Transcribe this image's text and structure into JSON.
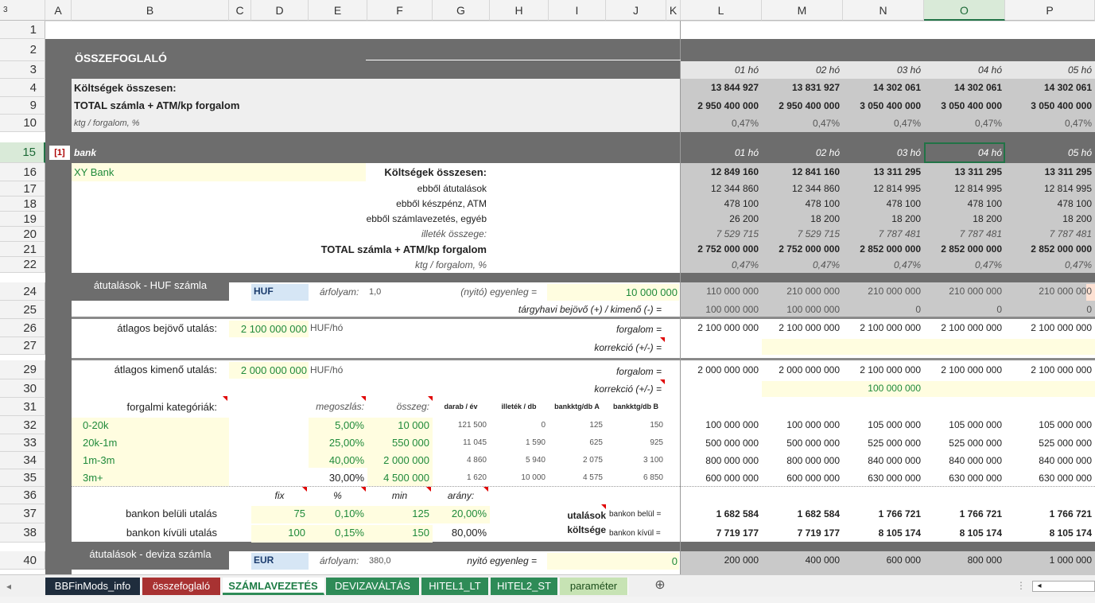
{
  "corner": "3",
  "columns": [
    "A",
    "B",
    "C",
    "D",
    "E",
    "F",
    "G",
    "H",
    "I",
    "J",
    "K",
    "L",
    "M",
    "N",
    "O",
    "P"
  ],
  "selected_column": "O",
  "rows": [
    "1",
    "2",
    "3",
    "4",
    "9",
    "10",
    "15",
    "16",
    "17",
    "18",
    "19",
    "20",
    "21",
    "22",
    "24",
    "25",
    "26",
    "27",
    "29",
    "30",
    "31",
    "32",
    "33",
    "34",
    "35",
    "36",
    "37",
    "38",
    "40"
  ],
  "selected_row": "15",
  "summary": {
    "title": "ÖSSZEFOGLALÓ",
    "months": [
      "01 hó",
      "02 hó",
      "03 hó",
      "04 hó",
      "05 hó"
    ],
    "row4_label": "Költségek összesen:",
    "row4_values": [
      "13 844 927",
      "13 831 927",
      "14 302 061",
      "14 302 061",
      "14 302 061"
    ],
    "row9_label": "TOTAL számla + ATM/kp forgalom",
    "row9_values": [
      "2 950 400 000",
      "2 950 400 000",
      "3 050 400 000",
      "3 050 400 000",
      "3 050 400 000"
    ],
    "row10_label": "ktg / forgalom, %",
    "row10_values": [
      "0,47%",
      "0,47%",
      "0,47%",
      "0,47%",
      "0,47%"
    ]
  },
  "bank": {
    "index": "[1]",
    "label": "bank",
    "months": [
      "01 hó",
      "02 hó",
      "03 hó",
      "04 hó",
      "05 hó"
    ],
    "name": "XY Bank",
    "r16_label": "Költségek összesen:",
    "r16": [
      "12 849 160",
      "12 841 160",
      "13 311 295",
      "13 311 295",
      "13 311 295"
    ],
    "r17_label": "ebből átutalások",
    "r17": [
      "12 344 860",
      "12 344 860",
      "12 814 995",
      "12 814 995",
      "12 814 995"
    ],
    "r18_label": "ebből készpénz, ATM",
    "r18": [
      "478 100",
      "478 100",
      "478 100",
      "478 100",
      "478 100"
    ],
    "r19_label": "ebből számlavezetés, egyéb",
    "r19": [
      "26 200",
      "18 200",
      "18 200",
      "18 200",
      "18 200"
    ],
    "r20_label": "illeték összege:",
    "r20": [
      "7 529 715",
      "7 529 715",
      "7 787 481",
      "7 787 481",
      "7 787 481"
    ],
    "r21_label": "TOTAL számla + ATM/kp forgalom",
    "r21": [
      "2 752 000 000",
      "2 752 000 000",
      "2 852 000 000",
      "2 852 000 000",
      "2 852 000 000"
    ],
    "r22_label": "ktg / forgalom, %",
    "r22": [
      "0,47%",
      "0,47%",
      "0,47%",
      "0,47%",
      "0,47%"
    ]
  },
  "huf": {
    "section_title": "átutalások - HUF számla",
    "currency": "HUF",
    "rate_label": "árfolyam:",
    "rate": "1,0",
    "opening_label": "(nyitó) egyenleg =",
    "opening": "10 000 000",
    "r24": [
      "110 000 000",
      "210 000 000",
      "210 000 000",
      "210 000 000",
      "210 000 000"
    ],
    "r25_label": "tárgyhavi bejövő (+) / kimenő (-) =",
    "r25": [
      "100 000 000",
      "100 000 000",
      "0",
      "0",
      "0"
    ],
    "in_label": "átlagos bejövő utalás:",
    "in_value": "2 100 000 000",
    "unit": "HUF/hó",
    "forgalom_label": "forgalom =",
    "r26": [
      "2 100 000 000",
      "2 100 000 000",
      "2 100 000 000",
      "2 100 000 000",
      "2 100 000 000"
    ],
    "korr_label": "korrekció (+/-) =",
    "out_label": "átlagos kimenő utalás:",
    "out_value": "2 000 000 000",
    "r29": [
      "2 000 000 000",
      "2 000 000 000",
      "2 100 000 000",
      "2 100 000 000",
      "2 100 000 000"
    ],
    "r30_n": "100 000 000"
  },
  "categories": {
    "label": "forgalmi kategóriák:",
    "headers": [
      "megoszlás:",
      "összeg:",
      "darab / év",
      "illeték / db",
      "bankktg/db A",
      "bankktg/db B"
    ],
    "rows": [
      {
        "name": "0-20k",
        "share": "5,00%",
        "amount": "10 000",
        "count": "121 500",
        "fee": "0",
        "a": "125",
        "b": "150",
        "m": [
          "100 000 000",
          "100 000 000",
          "105 000 000",
          "105 000 000",
          "105 000 000"
        ]
      },
      {
        "name": "20k-1m",
        "share": "25,00%",
        "amount": "550 000",
        "count": "11 045",
        "fee": "1 590",
        "a": "625",
        "b": "925",
        "m": [
          "500 000 000",
          "500 000 000",
          "525 000 000",
          "525 000 000",
          "525 000 000"
        ]
      },
      {
        "name": "1m-3m",
        "share": "40,00%",
        "amount": "2 000 000",
        "count": "4 860",
        "fee": "5 940",
        "a": "2 075",
        "b": "3 100",
        "m": [
          "800 000 000",
          "800 000 000",
          "840 000 000",
          "840 000 000",
          "840 000 000"
        ]
      },
      {
        "name": "3m+",
        "share": "30,00%",
        "amount": "4 500 000",
        "count": "1 620",
        "fee": "10 000",
        "a": "4 575",
        "b": "6 850",
        "m": [
          "600 000 000",
          "600 000 000",
          "630 000 000",
          "630 000 000",
          "630 000 000"
        ]
      }
    ]
  },
  "fees": {
    "headers": [
      "fix",
      "%",
      "min",
      "arány:"
    ],
    "inner_label": "bankon belüli utalás",
    "inner": [
      "75",
      "0,10%",
      "125",
      "20,00%"
    ],
    "outer_label": "bankon kívüli utalás",
    "outer": [
      "100",
      "0,15%",
      "150",
      "80,00%"
    ],
    "cost_label_1": "utalások",
    "cost_label_2": "költsége",
    "inner_tag": "bankon belül =",
    "outer_tag": "bankon kívül =",
    "r37": [
      "1 682 584",
      "1 682 584",
      "1 766 721",
      "1 766 721",
      "1 766 721"
    ],
    "r38": [
      "7 719 177",
      "7 719 177",
      "8 105 174",
      "8 105 174",
      "8 105 174"
    ]
  },
  "eur": {
    "section_title": "átutalások - deviza számla",
    "currency": "EUR",
    "rate_label": "árfolyam:",
    "rate": "380,0",
    "opening_label": "nyitó egyenleg =",
    "opening": "0",
    "r40": [
      "200 000",
      "400 000",
      "600 000",
      "800 000",
      "1 000 000"
    ]
  },
  "tabs": [
    {
      "label": "BBFinMods_info",
      "color": "#1f2d3d"
    },
    {
      "label": "összefoglaló",
      "color": "#a83232"
    },
    {
      "label": "SZÁMLAVEZETÉS",
      "color": "#2e8b57",
      "active": true
    },
    {
      "label": "DEVIZAVÁLTÁS",
      "color": "#2e8b57"
    },
    {
      "label": "HITEL1_LT",
      "color": "#2e8b57"
    },
    {
      "label": "HITEL2_ST",
      "color": "#2e8b57"
    },
    {
      "label": "paraméter",
      "color": "#c7e3b4"
    }
  ],
  "add_sheet": "⊕"
}
